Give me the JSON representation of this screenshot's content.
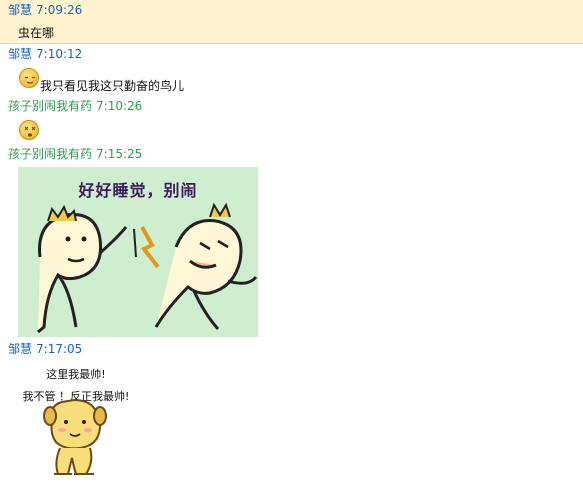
{
  "messages": [
    {
      "sender": "邹慧",
      "time": "7:09:26",
      "text": "虫在哪",
      "highlighted": true
    },
    {
      "sender": "邹慧",
      "time": "7:10:12",
      "emoji": "relieved-face-emoji",
      "text": "我只看见我这只勤奋的鸟儿"
    },
    {
      "sender": "孩子别闹我有药",
      "time": "7:10:26",
      "emoji": "dizzy-face-emoji"
    },
    {
      "sender": "孩子别闹我有药",
      "time": "7:15:25",
      "image_caption": "好好睡觉，别闹"
    },
    {
      "sender": "邹慧",
      "time": "7:17:05",
      "image_lines": [
        "这里我最帅!",
        "我不管 ！反正我最帅!"
      ]
    }
  ],
  "colors": {
    "sender_blue": "#1565c0",
    "sender_green": "#2e9e4f",
    "highlight_bg": "#fff4cf",
    "meme_bg": "#cfeed0"
  }
}
